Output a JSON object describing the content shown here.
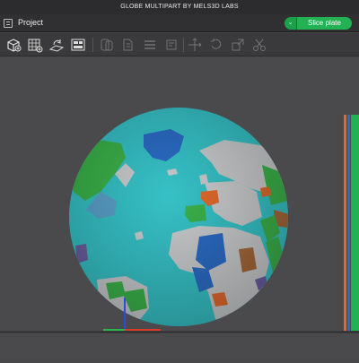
{
  "window": {
    "title": "GLOBE MULTIPART BY MELS3D LABS"
  },
  "menubar": {
    "project_label": "Project",
    "slice_label": "Slice plate",
    "slice_dropdown_glyph": "⌄"
  },
  "toolbar": {
    "tools": [
      {
        "name": "add-object-icon"
      },
      {
        "name": "add-plate-icon"
      },
      {
        "name": "auto-orient-icon"
      },
      {
        "name": "arrange-icon"
      },
      {
        "name": "split-objects-icon"
      },
      {
        "name": "split-parts-icon"
      },
      {
        "name": "layers-icon"
      },
      {
        "name": "variable-layer-icon"
      },
      {
        "name": "move-icon"
      },
      {
        "name": "rotate-icon"
      },
      {
        "name": "scale-icon"
      },
      {
        "name": "cut-icon"
      }
    ]
  },
  "colors": {
    "ocean": "#36c1c6",
    "land_default": "#c7c9cb",
    "accent_green": "#22b254",
    "blue_part": "#2b6bc4",
    "green_part": "#3bb24a",
    "orange_part": "#e06a2c",
    "brown_part": "#a4683a",
    "purple_part": "#6a5fa0"
  }
}
